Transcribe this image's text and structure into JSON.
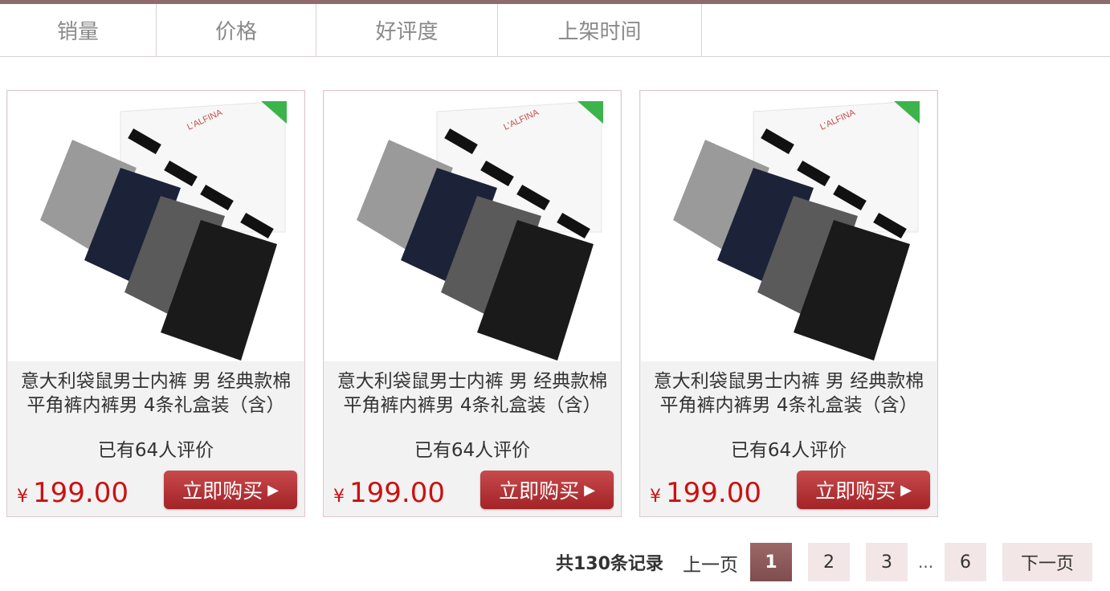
{
  "sort_tabs": [
    "销量",
    "价格",
    "好评度",
    "上架时间"
  ],
  "products": [
    {
      "title": "意大利袋鼠男士内裤 男 经典款棉平角裤内裤男 4条礼盒装（含）",
      "reviews": "已有64人评价",
      "currency": "¥",
      "price": "199.00",
      "buy_label": "立即购买",
      "brand": "L'ALFINA"
    },
    {
      "title": "意大利袋鼠男士内裤 男 经典款棉平角裤内裤男 4条礼盒装（含）",
      "reviews": "已有64人评价",
      "currency": "¥",
      "price": "199.00",
      "buy_label": "立即购买",
      "brand": "L'ALFINA"
    },
    {
      "title": "意大利袋鼠男士内裤 男 经典款棉平角裤内裤男 4条礼盒装（含）",
      "reviews": "已有64人评价",
      "currency": "¥",
      "price": "199.00",
      "buy_label": "立即购买",
      "brand": "L'ALFINA"
    }
  ],
  "pagination": {
    "total": "共130条记录",
    "prev": "上一页",
    "pages": [
      "1",
      "2",
      "3"
    ],
    "ellipsis": "...",
    "last": "6",
    "next": "下一页",
    "current": "1"
  },
  "colors": {
    "accent": "#8f6b6b",
    "price": "#cc1111",
    "buy_button": "#b23437"
  }
}
